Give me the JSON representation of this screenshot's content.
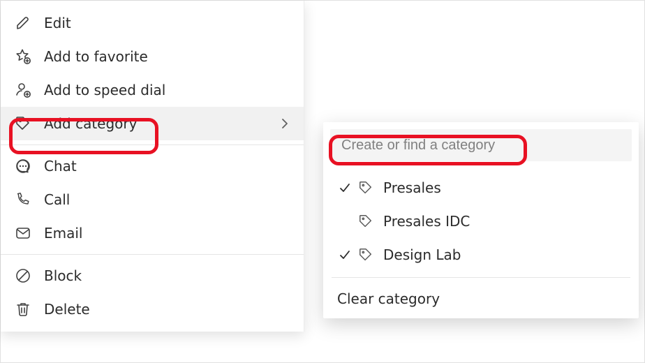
{
  "menu": {
    "items": [
      {
        "icon": "pencil",
        "label": "Edit",
        "has_submenu": false
      },
      {
        "icon": "star-plus",
        "label": "Add to favorite",
        "has_submenu": false
      },
      {
        "icon": "person-plus",
        "label": "Add to speed dial",
        "has_submenu": false
      },
      {
        "icon": "tag",
        "label": "Add category",
        "has_submenu": true,
        "hovered": true
      }
    ],
    "items2": [
      {
        "icon": "chat",
        "label": "Chat"
      },
      {
        "icon": "phone",
        "label": "Call"
      },
      {
        "icon": "mail",
        "label": "Email"
      }
    ],
    "items3": [
      {
        "icon": "block",
        "label": "Block"
      },
      {
        "icon": "trash",
        "label": "Delete"
      }
    ]
  },
  "flyout": {
    "search_placeholder": "Create or find a category",
    "categories": [
      {
        "label": "Presales",
        "checked": true
      },
      {
        "label": "Presales IDC",
        "checked": false
      },
      {
        "label": "Design Lab",
        "checked": true
      }
    ],
    "clear_label": "Clear category"
  },
  "colors": {
    "hover_bg": "#f1f1f1",
    "highlight": "#e81123",
    "separator": "#e5e5e5",
    "placeholder": "#808080"
  }
}
